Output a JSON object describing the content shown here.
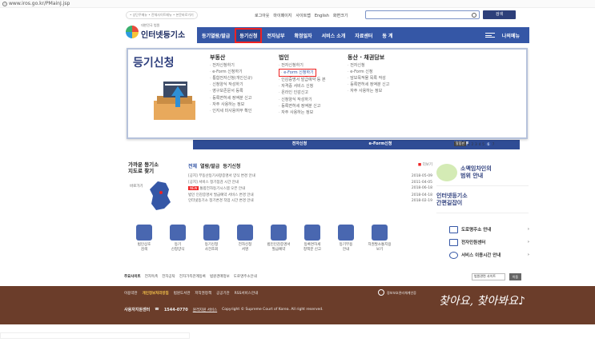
{
  "browser": {
    "url": "www.iros.go.kr/PMainJ.jsp"
  },
  "top": {
    "small_links": "• 상단주메뉴 • 전체사이트메뉴 • 본문바로가기",
    "util": [
      "로그아웃",
      "마이페이지",
      "사이트맵",
      "English",
      "화면크기"
    ],
    "search_button": "검색"
  },
  "logo": {
    "sub": "대한민국 법원",
    "main": "인터넷등기소"
  },
  "gnb": {
    "items": [
      "등기열람/발급",
      "등기신청",
      "전자납부",
      "확정일자",
      "서비스 소개",
      "자료센터",
      "동 계"
    ],
    "active": "등기신청",
    "mymenu": "나의메뉴"
  },
  "dropdown": {
    "title": "등기신청",
    "columns": [
      {
        "heading": "부동산",
        "items": [
          "전자신청하기",
          "e-Form 신청하기",
          "통합전자신청(개인신규)",
          "신청양식 작성하기",
          "영구보존문서 등록",
          "등록면허세 정액분 신고",
          "자주 사용하는 정보",
          "인지세 미사용여부 확인"
        ]
      },
      {
        "heading": "법인",
        "items": [
          "전자신청하기",
          "e-Form 신청하기",
          "인감증명서 발급예약 등 본",
          "자격증 서비스 신청",
          "온라인 인감신고",
          "신청양식 작성하기",
          "등록면허세 정액분 신고",
          "자주 사용하는 정보"
        ]
      },
      {
        "heading": "동산 · 채권담보",
        "items": [
          "전자신청",
          "e-Form 신청",
          "담보목적물 목록 작성",
          "등록면허세 정액분 신고",
          "자주 사용하는 정보"
        ]
      }
    ]
  },
  "banner": {
    "tabs": [
      "전자신청",
      "e-Form신청",
      "전자납부"
    ],
    "pager_live": "알림판",
    "pages": [
      "1",
      "2",
      "3",
      "4",
      "5",
      "6",
      "7"
    ],
    "current_page": "6"
  },
  "nearby": {
    "title_l1": "가까운 등기소",
    "title_l2": "지도로 찾기",
    "link": "바로가기"
  },
  "notice": {
    "tabs": [
      "전체",
      "열람/발급",
      "등기신청"
    ],
    "more": "더보기",
    "rows": [
      {
        "title": "[공지] 부동산등기사항증명서 양식 변경 안내",
        "date": "2018-05-09",
        "new": ""
      },
      {
        "title": "[공지] 서비스 정기점검 시간 안내",
        "date": "2011-04-05",
        "new": ""
      },
      {
        "title": "통합전자등기시스템 오픈 안내",
        "date": "2018-06-18",
        "new": "NEW"
      },
      {
        "title": "법인 인감증명서 발급예약 서비스 변경 안내",
        "date": "2018-04-18",
        "new": ""
      },
      {
        "title": "인터넷등기소 정기변경 작업 시간 변경 안내",
        "date": "2018-02-19",
        "new": ""
      }
    ]
  },
  "promos": {
    "p1_l1": "소액임차인의",
    "p1_l2": "범위 안내",
    "p2_l1": "인터넷등기소",
    "p2_l2": "간편길잡이"
  },
  "side_links": [
    "도로명주소 안내",
    "전자민원센터",
    "서비스 이용시간 안내"
  ],
  "quick": [
    {
      "l1": "법인상호",
      "l2": "검색"
    },
    {
      "l1": "등기",
      "l2": "신청양식"
    },
    {
      "l1": "등기신청",
      "l2": "사건조회"
    },
    {
      "l1": "전자신청",
      "l2": "서명"
    },
    {
      "l1": "법인인감증명서",
      "l2": "발급예약"
    },
    {
      "l1": "등록면허세",
      "l2": "정액분 신고"
    },
    {
      "l1": "등기부용",
      "l2": "안내"
    },
    {
      "l1": "자권발소통지용",
      "l2": "보기"
    }
  ],
  "footer_nav": {
    "label": "주요사이트",
    "items": [
      "전자독촉",
      "전자공탁",
      "전자가족관계등록",
      "법원경매정보",
      "도로명주소안내"
    ],
    "select": "법원관련 사이트",
    "go": "이동"
  },
  "footer": {
    "row1": [
      "이용약관",
      "개인정보처리방침",
      "법원도서관",
      "저작권정책",
      "공공기관",
      "RSS서비스안내"
    ],
    "row2_label": "사용자지원센터",
    "row2_phone": "1544-0770",
    "row2_extra": "원격지원 서비스",
    "copyright": "Copyright © Supreme Court of Korea. All right reserved.",
    "mark": "정보보호관리체계인증",
    "slogan": "찾아요, 찾아봐요♪"
  }
}
